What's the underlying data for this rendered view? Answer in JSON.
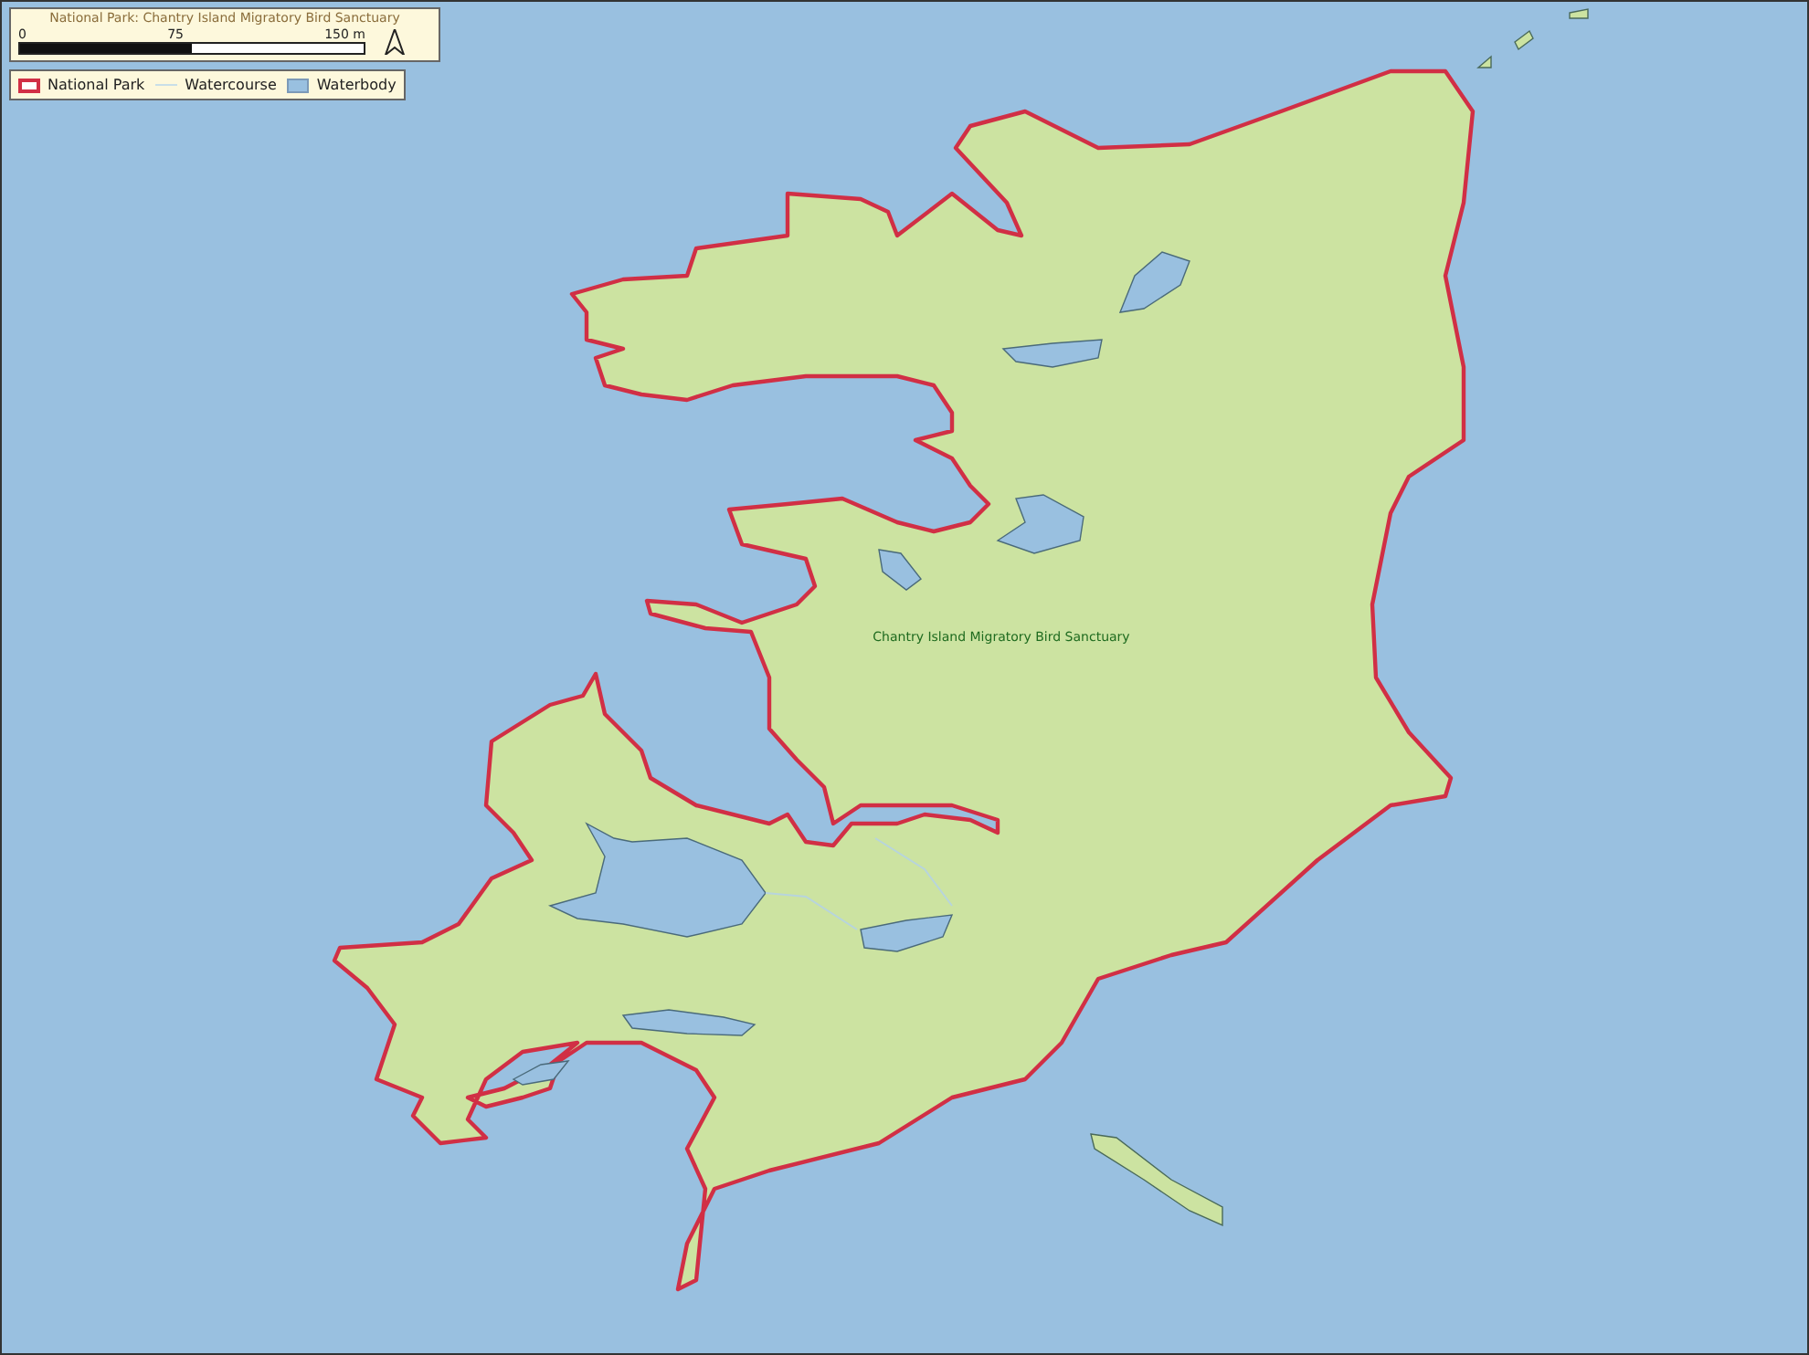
{
  "title": "National Park: Chantry Island Migratory Bird Sanctuary",
  "scale_bar": {
    "labels": [
      "0",
      "75",
      "150 m"
    ]
  },
  "legend": [
    {
      "kind": "outline",
      "label": "National Park"
    },
    {
      "kind": "line",
      "label": "Watercourse"
    },
    {
      "kind": "fill",
      "label": "Waterbody"
    }
  ],
  "map_label": "Chantry Island Migratory Bird Sanctuary"
}
